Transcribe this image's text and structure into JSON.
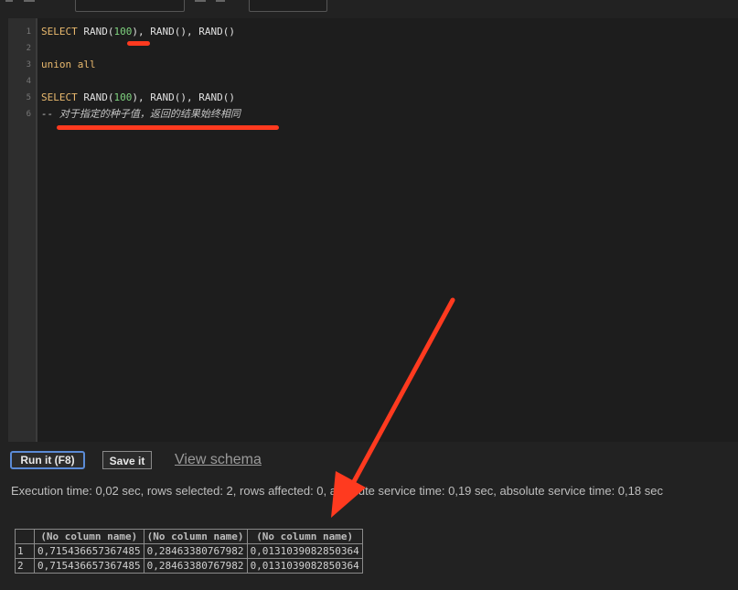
{
  "editor": {
    "line_numbers": [
      "1",
      "2",
      "3",
      "4",
      "5",
      "6"
    ],
    "lines": {
      "l1": {
        "kw": "SELECT",
        "fn_a": " RAND(",
        "num": "100",
        "rest": "), RAND(), RAND()"
      },
      "l3": {
        "kw": "union all"
      },
      "l5": {
        "kw": "SELECT",
        "fn_a": " RAND(",
        "num": "100",
        "rest": "), RAND(), RAND()"
      },
      "l6": {
        "comment": "-- 对于指定的种子值，返回的结果始终相同"
      }
    }
  },
  "toolbar": {
    "run_label": "Run it (F8)",
    "save_label": "Save it",
    "schema_label": "View schema"
  },
  "status": {
    "execution": "Execution time: 0,02 sec, rows selected: 2, rows affected: 0, absolute service time: 0,19 sec, absolute service time: 0,18 sec"
  },
  "results": {
    "headers": [
      "",
      "(No column name)",
      "(No column name)",
      "(No column name)"
    ],
    "rows": [
      [
        "1",
        "0,715436657367485",
        "0,28463380767982",
        "0,0131039082850364"
      ],
      [
        "2",
        "0,715436657367485",
        "0,28463380767982",
        "0,0131039082850364"
      ]
    ]
  },
  "colors": {
    "annotation": "#ff3a1f",
    "keyword": "#e9b96e",
    "number": "#7fd37f",
    "run_border": "#5b8bd6"
  }
}
